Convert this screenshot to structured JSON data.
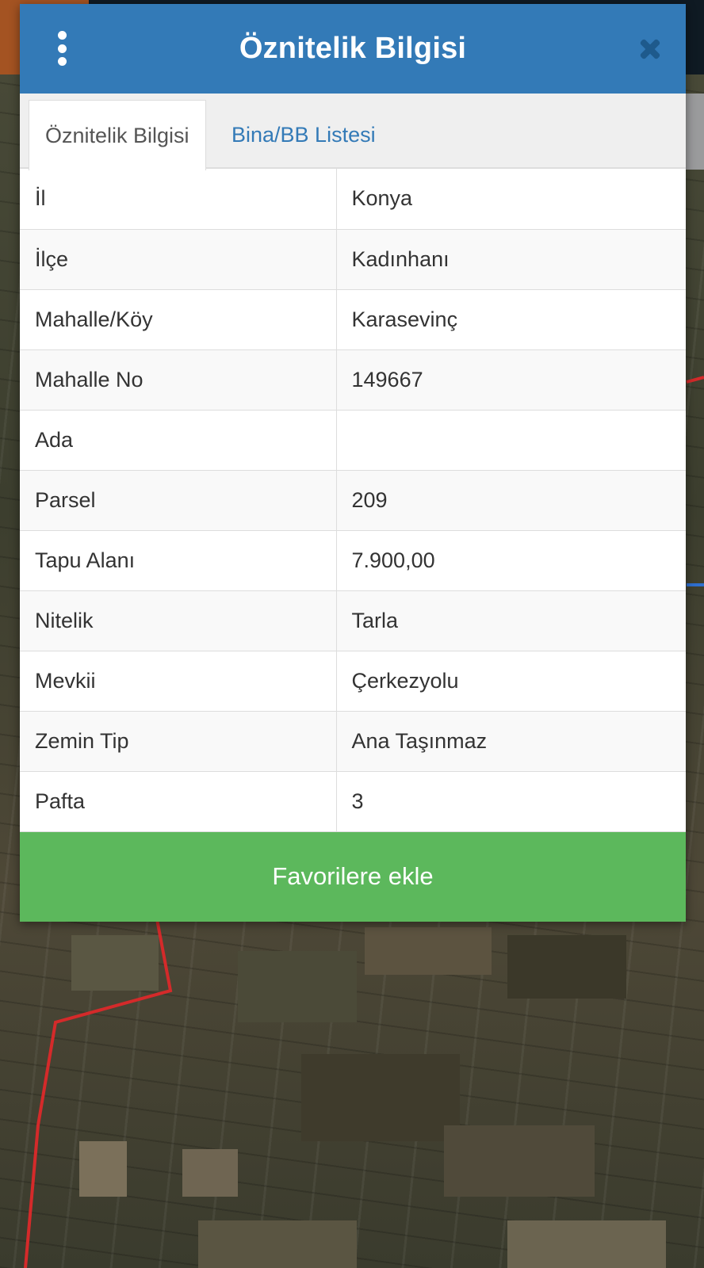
{
  "dialog": {
    "title": "Öznitelik Bilgisi",
    "menu_icon": "more-vertical-icon",
    "close_icon": "close-icon"
  },
  "tabs": [
    {
      "label": "Öznitelik Bilgisi",
      "active": true
    },
    {
      "label": "Bina/BB Listesi",
      "active": false
    }
  ],
  "attributes": [
    {
      "key": "İl",
      "value": "Konya"
    },
    {
      "key": "İlçe",
      "value": "Kadınhanı"
    },
    {
      "key": "Mahalle/Köy",
      "value": "Karasevinç"
    },
    {
      "key": "Mahalle No",
      "value": "149667"
    },
    {
      "key": "Ada",
      "value": ""
    },
    {
      "key": "Parsel",
      "value": "209"
    },
    {
      "key": "Tapu Alanı",
      "value": "7.900,00"
    },
    {
      "key": "Nitelik",
      "value": "Tarla"
    },
    {
      "key": "Mevkii",
      "value": "Çerkezyolu"
    },
    {
      "key": "Zemin Tip",
      "value": "Ana Taşınmaz"
    },
    {
      "key": "Pafta",
      "value": "3"
    }
  ],
  "actions": {
    "favorite_label": "Favorilere ekle"
  },
  "colors": {
    "header": "#337ab7",
    "tab_link": "#337ab7",
    "favorite_button": "#5cb85c",
    "parcel_border": "#d42a2a",
    "road_line": "#2f6fd0"
  }
}
